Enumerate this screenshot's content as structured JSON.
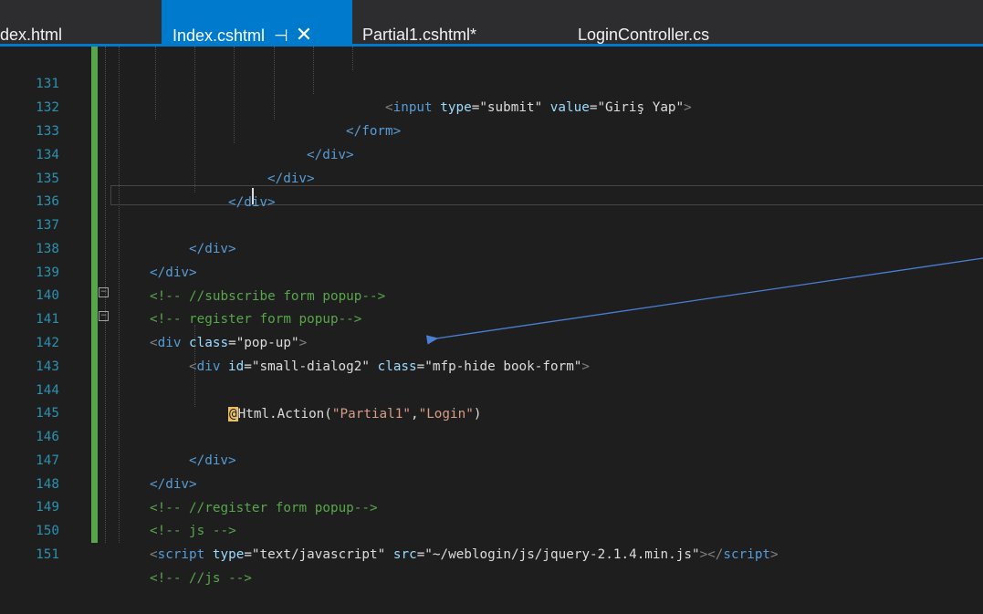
{
  "tabs": [
    {
      "label": "dex.html",
      "active": false
    },
    {
      "label": "Index.cshtml",
      "active": true,
      "pin_icon": "pin-icon",
      "close_icon": "close-icon"
    },
    {
      "label": "Partial1.cshtml*",
      "active": false
    },
    {
      "label": "LoginController.cs",
      "active": false
    }
  ],
  "tab_pin_glyph": "⊣",
  "tab_close_glyph": "✕",
  "lines": [
    {
      "num": "131"
    },
    {
      "num": "132"
    },
    {
      "num": "133"
    },
    {
      "num": "134"
    },
    {
      "num": "135"
    },
    {
      "num": "136"
    },
    {
      "num": "137"
    },
    {
      "num": "138"
    },
    {
      "num": "139"
    },
    {
      "num": "140"
    },
    {
      "num": "141"
    },
    {
      "num": "142"
    },
    {
      "num": "143"
    },
    {
      "num": "144"
    },
    {
      "num": "145"
    },
    {
      "num": "146"
    },
    {
      "num": "147"
    },
    {
      "num": "148"
    },
    {
      "num": "149"
    },
    {
      "num": "150"
    },
    {
      "num": "151"
    }
  ],
  "code": {
    "l131": {
      "open": "<",
      "tag": "input",
      "a1": " type",
      "eq1": "=",
      "v1": "\"submit\"",
      "a2": " value",
      "eq2": "=",
      "v2": "\"Giriş Yap\"",
      "close": ">"
    },
    "l132": {
      "text": "</form>"
    },
    "l133": {
      "text": "</div>"
    },
    "l134": {
      "text": "</div>"
    },
    "l135": {
      "text": "</div>"
    },
    "l137": {
      "text": "</div>"
    },
    "l138": {
      "text": "</div>"
    },
    "l139": {
      "text": "<!-- //subscribe form popup-->"
    },
    "l140": {
      "text": "<!-- register form popup-->"
    },
    "l141": {
      "open": "<",
      "tag": "div",
      "a1": " class",
      "eq1": "=",
      "v1": "\"pop-up\"",
      "close": ">"
    },
    "l142": {
      "open": "<",
      "tag": "div",
      "a1": " id",
      "eq1": "=",
      "v1": "\"small-dialog2\"",
      "a2": " class",
      "eq2": "=",
      "v2": "\"mfp-hide book-form\"",
      "close": ">"
    },
    "l144": {
      "at": "@",
      "method": "Html.Action(",
      "s1": "\"Partial1\"",
      "comma": ",",
      "s2": "\"Login\"",
      "end": ")"
    },
    "l146": {
      "text": "</div>"
    },
    "l147": {
      "text": "</div>"
    },
    "l148": {
      "text": "<!-- //register form popup-->"
    },
    "l149": {
      "text": "<!-- js -->"
    },
    "l150": {
      "open": "<",
      "tag": "script",
      "a1": " type",
      "eq1": "=",
      "v1": "\"text/javascript\"",
      "a2": " src",
      "eq2": "=",
      "v2": "\"~/weblogin/js/jquery-2.1.4.min.js\"",
      "close": "></",
      "tag2": "script",
      "close2": ">"
    },
    "l151": {
      "text": "<!-- //js -->"
    }
  },
  "colors": {
    "background": "#1e1e1e",
    "tab_active": "#007acc",
    "line_number": "#2b91af",
    "html_tag": "#569cd6",
    "attribute": "#9cdcfe",
    "string": "#d69d85",
    "comment": "#57a64a",
    "arrow": "#4a7fd4"
  },
  "icons": {
    "collapse_141": "collapse-minus-icon",
    "collapse_142": "collapse-minus-icon",
    "arrow": "annotation-arrow"
  }
}
